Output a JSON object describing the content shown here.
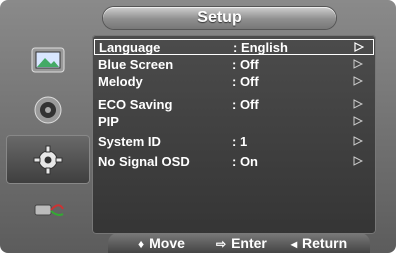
{
  "title": "Setup",
  "sidebar": [
    {
      "icon": "picture-icon",
      "active": false
    },
    {
      "icon": "sound-icon",
      "active": false
    },
    {
      "icon": "gear-icon",
      "active": true
    },
    {
      "icon": "input-icon",
      "active": false
    }
  ],
  "menu": [
    {
      "label": "Language",
      "value": ": English",
      "selected": true
    },
    {
      "label": "Blue Screen",
      "value": ": Off"
    },
    {
      "label": "Melody",
      "value": ": Off"
    },
    {
      "label": "ECO Saving",
      "value": ": Off"
    },
    {
      "label": "PIP",
      "value": ""
    },
    {
      "label": "System ID",
      "value": ": 1"
    },
    {
      "label": "No Signal OSD",
      "value": ": On"
    }
  ],
  "footer": {
    "move": "Move",
    "move_icon": "updown-icon",
    "enter": "Enter",
    "enter_icon": "enter-icon",
    "return": "Return",
    "return_icon": "back-icon"
  }
}
